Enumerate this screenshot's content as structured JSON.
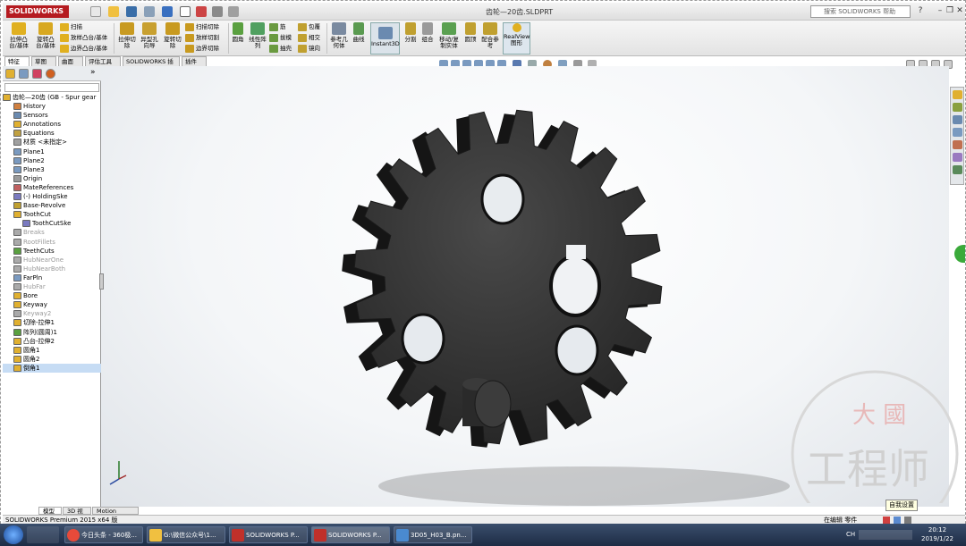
{
  "app": {
    "logo": "SOLIDWORKS",
    "doc_title": "齿轮—20齿.SLDPRT",
    "help_search_placeholder": "搜索 SOLIDWORKS 帮助"
  },
  "ribbon": {
    "extrude_boss": "拉伸凸\n台/基体",
    "revolve_boss": "旋转凸\n台/基体",
    "sweep": "扫描",
    "loft": "放样凸台/基体",
    "boundary_boss": "边界凸台/基体",
    "extruded_cut": "拉伸切\n除",
    "hole_wizard": "异型孔\n向导",
    "revolved_cut": "旋转切\n除",
    "swept_cut": "扫描切除",
    "lofted_cut": "放样切割",
    "boundary_cut": "边界切除",
    "fillet": "圆角",
    "linear_pattern": "线性阵\n列",
    "rib": "筋",
    "draft": "拔模",
    "shell": "抽壳",
    "wrap": "包覆",
    "intersect": "相交",
    "mirror": "镜向",
    "ref_geometry": "参考几\n何体",
    "curves": "曲线",
    "instant3d": "Instant3D",
    "split": "分割",
    "combine": "组合",
    "move_copy": "移动/复\n制实体",
    "dome": "圆顶",
    "mate_ref": "配合参\n考",
    "realview": "RealView\n图形"
  },
  "command_tabs": [
    "特征",
    "草图",
    "曲面",
    "评估工具",
    "SOLIDWORKS 插件",
    "插件(3)"
  ],
  "feature_tree": {
    "root": "齿轮—20齿 (GB - Spur gear",
    "items": [
      {
        "label": "History",
        "dim": false
      },
      {
        "label": "Sensors",
        "dim": false
      },
      {
        "label": "Annotations",
        "dim": false
      },
      {
        "label": "Equations",
        "dim": false
      },
      {
        "label": "材质 <未指定>",
        "dim": false
      },
      {
        "label": "Plane1",
        "dim": false
      },
      {
        "label": "Plane2",
        "dim": false
      },
      {
        "label": "Plane3",
        "dim": false
      },
      {
        "label": "Origin",
        "dim": false
      },
      {
        "label": "MateReferences",
        "dim": false
      },
      {
        "label": "(-) HoldingSke",
        "dim": false
      },
      {
        "label": "Base-Revolve",
        "dim": false
      },
      {
        "label": "ToothCut",
        "dim": false
      },
      {
        "label": "ToothCutSke",
        "dim": false
      },
      {
        "label": "Breaks",
        "dim": true
      },
      {
        "label": "RootFillets",
        "dim": true
      },
      {
        "label": "TeethCuts",
        "dim": false
      },
      {
        "label": "HubNearOne",
        "dim": true
      },
      {
        "label": "HubNearBoth",
        "dim": true
      },
      {
        "label": "FarPln",
        "dim": false
      },
      {
        "label": "HubFar",
        "dim": true
      },
      {
        "label": "Bore",
        "dim": false
      },
      {
        "label": "Keyway",
        "dim": false
      },
      {
        "label": "Keyway2",
        "dim": true
      },
      {
        "label": "切除-拉伸1",
        "dim": false
      },
      {
        "label": "阵列(圆周)1",
        "dim": false
      },
      {
        "label": "凸台-拉伸2",
        "dim": false
      },
      {
        "label": "圆角1",
        "dim": false
      },
      {
        "label": "圆角2",
        "dim": false
      },
      {
        "label": "倒角1",
        "dim": false,
        "selected": true
      }
    ]
  },
  "bottom_tabs": [
    "模型",
    "3D 视图",
    "Motion Study 1"
  ],
  "status": {
    "left": "SOLIDWORKS Premium 2015 x64 版",
    "right": "在编辑 零件",
    "tooltip": "自我设置"
  },
  "taskbar": {
    "items": [
      "今日头条 - 360极...",
      "G:\\微信公众号\\1...",
      "SOLIDWORKS P...",
      "SOLIDWORKS P...",
      "3D05_H03_B.pn..."
    ],
    "time": "20:12",
    "date": "2019/1/22",
    "tray_lang": "CH"
  },
  "watermark": {
    "line1": "大 國",
    "line2": "工程师"
  },
  "colors": {
    "gear": "#2c2c2c",
    "brand": "#b51b20",
    "selection": "#c6dcf4"
  }
}
